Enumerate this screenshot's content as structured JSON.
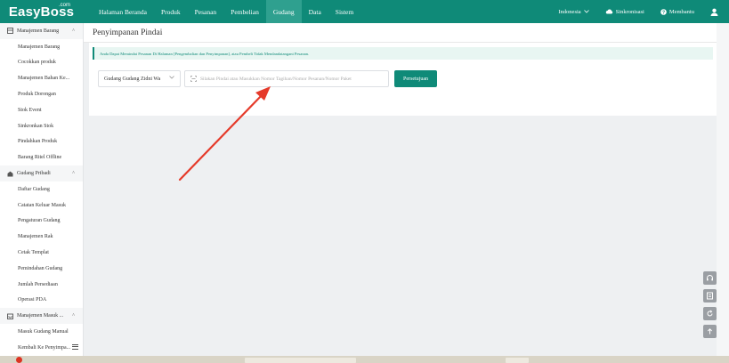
{
  "app": {
    "logo": "EasyBoss",
    "logo_suffix": ".com"
  },
  "nav": {
    "items": [
      {
        "label": "Halaman Beranda"
      },
      {
        "label": "Produk"
      },
      {
        "label": "Pesanan"
      },
      {
        "label": "Pembelian"
      },
      {
        "label": "Gudang",
        "active": true
      },
      {
        "label": "Data"
      },
      {
        "label": "Sistem"
      }
    ]
  },
  "header_right": {
    "language": "Indonesia",
    "sync": "Sinkronisasi",
    "help": "Membantu"
  },
  "sidebar": {
    "groups": [
      {
        "label": "Manajemen Barang",
        "items": [
          "Manajemen Barang",
          "Cocokkan produk",
          "Manajemen Bahan Ke...",
          "Produk Dorongan",
          "Stok Event",
          "Sinkronkan Stok",
          "Pindahkan Produk",
          "Barang Ritel Offline"
        ]
      },
      {
        "label": "Gudang Pribadi",
        "items": [
          "Daftar Gudang",
          "Catatan Keluar Masuk",
          "Pengaturan Gudang",
          "Manajemen Rak",
          "Cetak Templat",
          "Pemindahan Gudang",
          "Jumlah Persediaan",
          "Operasi PDA"
        ]
      },
      {
        "label": "Manajemen Masuk ...",
        "items": [
          "Masuk Gudang Manual",
          "Kembali Ke Penyimpa..."
        ]
      }
    ]
  },
  "page": {
    "title": "Penyimpanan Pindai",
    "notice": "Anda Dapat Memindai Pesanan Di Halaman [Pengembalian dan Penyimpanan], atau Pembeli Tidak Mendandatangani Pesanan.",
    "warehouse_select": "Gudang Gudang Zidni Wa",
    "scan_placeholder": "Silakan Pindai atau Masukkan Nomor Tagihan/Nomor Pesanan/Nomor Paket",
    "scan_value": "",
    "confirm_button": "Persetujuan"
  },
  "colors": {
    "brand": "#0f8a78",
    "annotation_arrow": "#e53a2a"
  },
  "icons": {
    "float_tools": [
      "headset-icon",
      "document-icon",
      "refresh-icon",
      "back-to-top-icon"
    ]
  }
}
